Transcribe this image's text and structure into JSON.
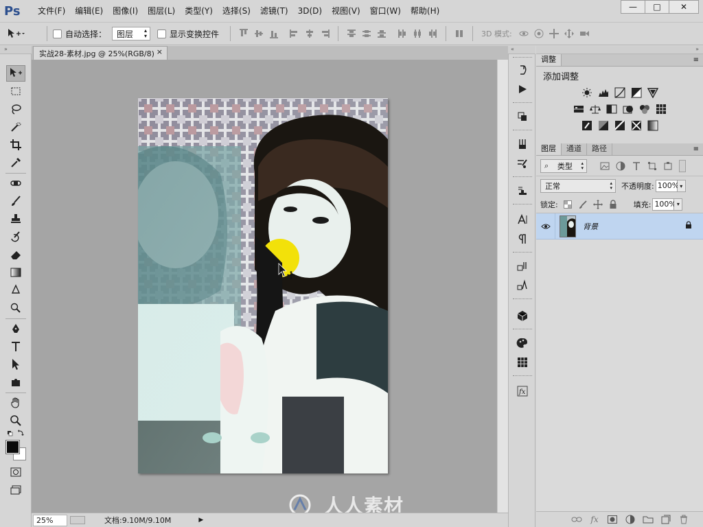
{
  "app": {
    "logo": "Ps"
  },
  "menu": [
    "文件(F)",
    "编辑(E)",
    "图像(I)",
    "图层(L)",
    "类型(Y)",
    "选择(S)",
    "滤镜(T)",
    "3D(D)",
    "视图(V)",
    "窗口(W)",
    "帮助(H)"
  ],
  "window_controls": {
    "minimize": "—",
    "maximize": "□",
    "close": "✕"
  },
  "options": {
    "auto_select_label": "自动选择：",
    "auto_select_target": "图层",
    "show_transform_label": "显示变换控件",
    "mode3d_label": "3D 模式:"
  },
  "document": {
    "tab_title": "实战28-素材.jpg @ 25%(RGB/8)",
    "tab_close": "×",
    "zoom": "25%",
    "doc_info": "文档:9.10M/9.10M",
    "watermark": "人人素材"
  },
  "adjustments": {
    "tab": "调整",
    "title": "添加调整"
  },
  "layers": {
    "tabs": [
      "图层",
      "通道",
      "路径"
    ],
    "filter_kind": "类型",
    "blend_mode": "正常",
    "opacity_label": "不透明度:",
    "opacity": "100%",
    "lock_label": "锁定:",
    "fill_label": "填充:",
    "fill": "100%",
    "items": [
      {
        "name": "背景",
        "visible": true,
        "locked": true
      }
    ]
  },
  "colors": {
    "chrome": "#d6d6d6",
    "canvas_bg": "#a5a5a5",
    "selected_layer": "#bfd5f0",
    "ps_blue": "#2c4f8e"
  }
}
